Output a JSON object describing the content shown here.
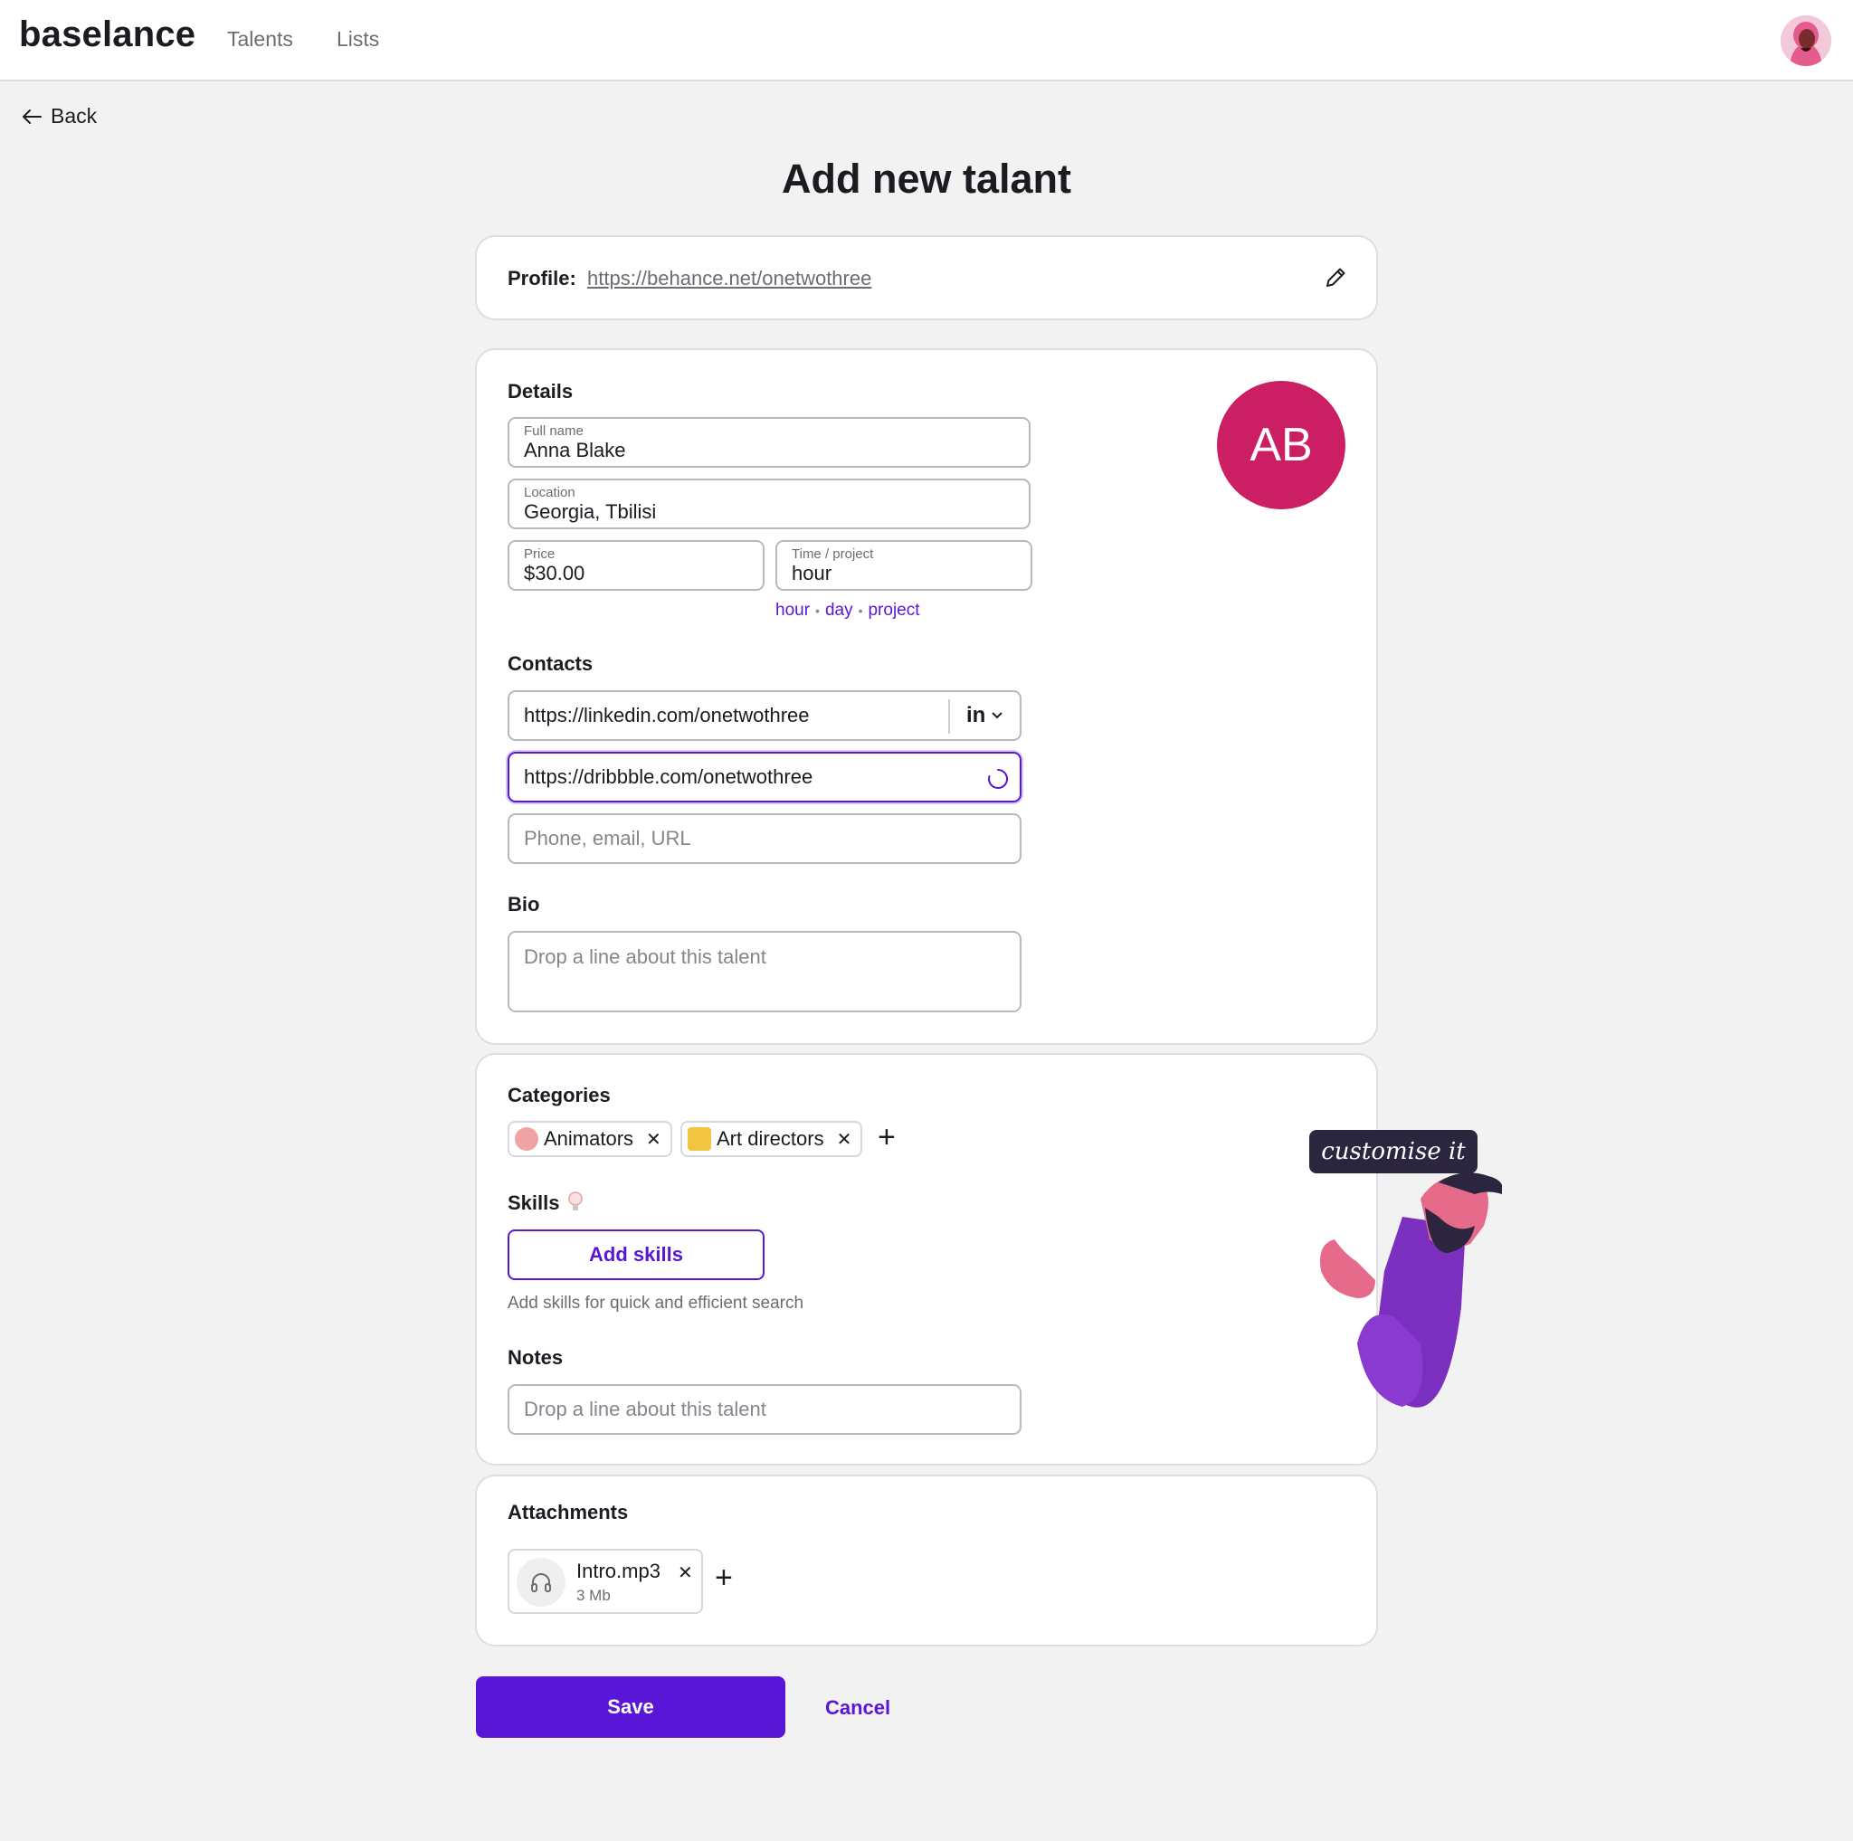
{
  "nav": {
    "logo": "baselance",
    "talents": "Talents",
    "lists": "Lists"
  },
  "back_label": "Back",
  "page_title": "Add new talant",
  "profile": {
    "label": "Profile:",
    "url": "https://behance.net/onetwothree"
  },
  "details": {
    "title": "Details",
    "initials": "AB",
    "avatar_color": "#cc1f63",
    "full_name": {
      "label": "Full name",
      "value": "Anna Blake"
    },
    "location": {
      "label": "Location",
      "value": "Georgia, Tbilisi"
    },
    "price": {
      "label": "Price",
      "value": "$30.00"
    },
    "time": {
      "label": "Time / project",
      "value": "hour",
      "options": [
        "hour",
        "day",
        "project"
      ]
    }
  },
  "contacts": {
    "title": "Contacts",
    "items": [
      "https://linkedin.com/onetwothree",
      "https://dribbble.com/onetwothree"
    ],
    "linkedin_badge": "in",
    "placeholder": "Phone, email, URL"
  },
  "bio": {
    "title": "Bio",
    "placeholder": "Drop a line about this talent"
  },
  "categories": {
    "title": "Categories",
    "chips": [
      {
        "label": "Animators",
        "icon": "fist-emoji"
      },
      {
        "label": "Art directors",
        "icon": "crown-emoji"
      }
    ]
  },
  "skills": {
    "title": "Skills",
    "button": "Add skills",
    "hint": "Add skills for quick and efficient search"
  },
  "notes": {
    "title": "Notes",
    "placeholder": "Drop a line about this talent"
  },
  "attachments": {
    "title": "Attachments",
    "files": [
      {
        "name": "Intro.mp3",
        "size": "3 Mb",
        "icon": "headphones-icon"
      }
    ]
  },
  "illustration": {
    "bubble": "customise it"
  },
  "actions": {
    "save": "Save",
    "cancel": "Cancel"
  },
  "colors": {
    "accent": "#5a16d6",
    "avatar": "#cc1f63",
    "background": "#f2f2f2"
  }
}
